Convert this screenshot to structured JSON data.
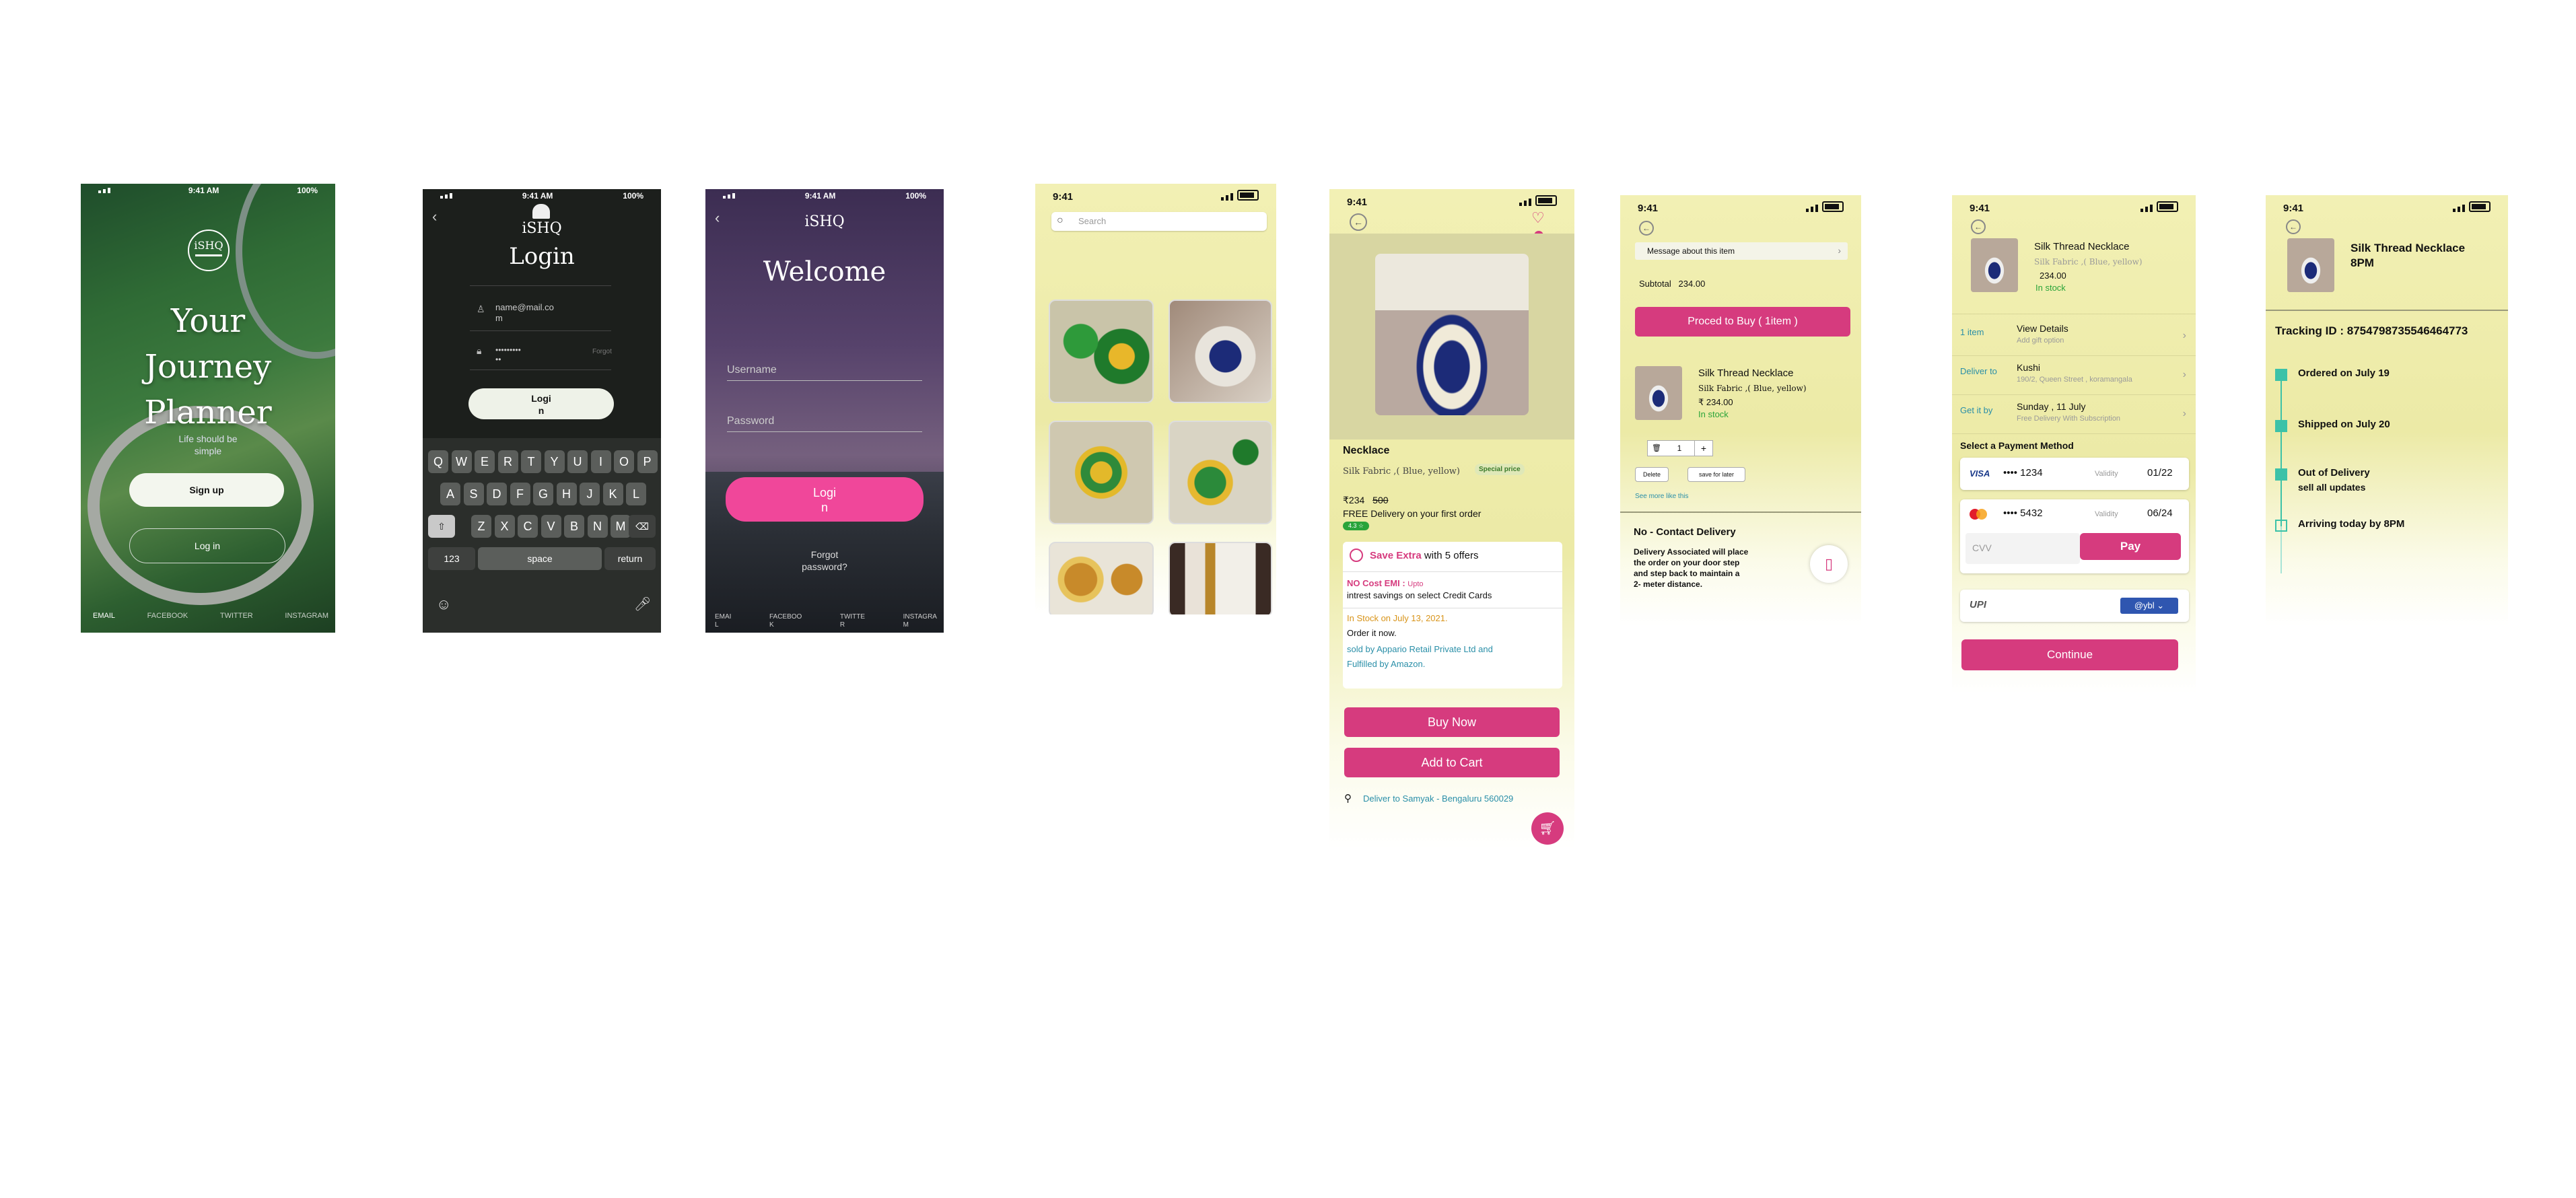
{
  "screen1": {
    "status_time": "9:41 AM",
    "status_battery": "100%",
    "logo": "iSHQ",
    "title_line1": "Your",
    "title_line2": "Journey",
    "title_line3": "Planner",
    "subtitle": "Life should be",
    "subtitle2": "simple",
    "signup_label": "Sign up",
    "login_label": "Log in",
    "social": [
      "EMAIL",
      "FACEBOOK",
      "TWITTER",
      "INSTAGRAM"
    ]
  },
  "screen2": {
    "status_time": "9:41 AM",
    "status_battery": "100%",
    "logo": "iSHQ",
    "title": "Login",
    "email_value": "name@mail.co",
    "email_value2": "m",
    "password_value": "•••••••••",
    "password_value2": "••",
    "forgot": "Forgot",
    "login_button": "Logi",
    "login_button2": "n",
    "keyboard_row1": [
      "Q",
      "W",
      "E",
      "R",
      "T",
      "Y",
      "U",
      "I",
      "O",
      "P"
    ],
    "keyboard_row2": [
      "A",
      "S",
      "D",
      "F",
      "G",
      "H",
      "J",
      "K",
      "L"
    ],
    "keyboard_row3": [
      "Z",
      "X",
      "C",
      "V",
      "B",
      "N",
      "M"
    ],
    "key_123": "123",
    "key_space": "space",
    "key_return": "return"
  },
  "screen3": {
    "status_time": "9:41 AM",
    "status_battery": "100%",
    "logo": "iSHQ",
    "title": "Welcome",
    "username_placeholder": "Username",
    "password_placeholder": "Password",
    "login_button": "Logi",
    "login_button2": "n",
    "forgot": "Forgot",
    "forgot2": "password?",
    "social": [
      "EMAI",
      "FACEBOO",
      "TWITTE",
      "INSTAGRA"
    ],
    "social2": [
      "L",
      "K",
      "R",
      "M"
    ]
  },
  "screen4": {
    "status_time": "9:41",
    "search_placeholder": "Search"
  },
  "screen5": {
    "status_time": "9:41",
    "product_name": "Necklace",
    "variant": "Silk Fabric ,( Blue, yellow)",
    "special_badge": "Special price",
    "price": "₹234",
    "old_price": "500",
    "free_delivery": "FREE Delivery on your first order",
    "rating": "4.3 ☆",
    "save_extra_bold": "Save Extra",
    "save_extra_rest": "with 5 offers",
    "no_cost_emi": "NO Cost EMI :",
    "upto": "Upto",
    "savings": "intrest savings on select Credit Cards",
    "stock": "In Stock on July 13, 2021.",
    "order": "Order it now.",
    "sold_by": "sold by Appario Retail Private Ltd and",
    "fulfilled": "Fulfilled by Amazon.",
    "buy_now": "Buy Now",
    "add_to_cart": "Add to Cart",
    "deliver_to": "Deliver to Samyak - Bengaluru 560029"
  },
  "screen6": {
    "status_time": "9:41",
    "message_label": "Message about this item",
    "subtotal_label": "Subtotal",
    "subtotal_value": "234.00",
    "proceed_button": "Proced to Buy ( 1item )",
    "item_name": "Silk Thread Necklace",
    "item_variant": "Silk Fabric ,( Blue, yellow)",
    "item_price": "₹ 234.00",
    "item_stock": "In stock",
    "quantity": "1",
    "delete_label": "Delete",
    "save_later_label": "save for later",
    "see_more": "See more like this",
    "contact_title": "No - Contact Delivery",
    "contact_body": [
      "Delivery Associated will place",
      "the order on your door step",
      "and step back to maintain a",
      "2- meter distance."
    ]
  },
  "screen7": {
    "status_time": "9:41",
    "item_name": "Silk Thread Necklace",
    "item_variant": "Silk Fabric ,( Blue, yellow)",
    "item_price": "234.00",
    "item_stock": "In stock",
    "rows": [
      {
        "label": "1 item",
        "title": "View Details",
        "sub": "Add gift option"
      },
      {
        "label": "Deliver to",
        "title": "Kushi",
        "sub": "190/2, Queen Street , koramangala"
      },
      {
        "label": "Get it by",
        "title": "Sunday ,   11 July",
        "sub": "Free Delivery With Subscription"
      }
    ],
    "select_payment": "Select a Payment Method",
    "visa_brand": "VISA",
    "visa_number": "•••• 1234",
    "visa_validity_label": "Validity",
    "visa_validity": "01/22",
    "mc_number": "•••• 5432",
    "mc_validity_label": "Validity",
    "mc_validity": "06/24",
    "cvv_placeholder": "CVV",
    "pay_button": "Pay",
    "upi_label": "UPI",
    "upi_handle": "@ybl",
    "continue_button": "Continue"
  },
  "screen8": {
    "status_time": "9:41",
    "item_name_line1": "Silk Thread Necklace",
    "item_name_line2": "8PM",
    "tracking": "Tracking ID : 8754798735546464773",
    "steps": [
      {
        "title": "Ordered on July 19",
        "sub": "",
        "done": true
      },
      {
        "title": "Shipped on July 20",
        "sub": "",
        "done": true
      },
      {
        "title": "Out of Delivery",
        "sub": "sell all updates",
        "done": true
      },
      {
        "title": "Arriving today by 8PM",
        "sub": "",
        "done": false
      }
    ]
  },
  "colors": {
    "accent_pink": "#d63b7e",
    "teal": "#2a8fa8",
    "in_stock_green": "#2aa43a",
    "track_green": "#3cc2a8"
  }
}
